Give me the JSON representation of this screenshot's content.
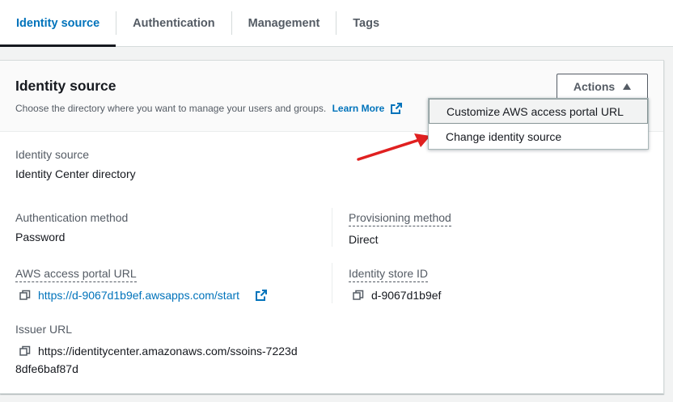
{
  "tabs": [
    {
      "label": "Identity source"
    },
    {
      "label": "Authentication"
    },
    {
      "label": "Management"
    },
    {
      "label": "Tags"
    }
  ],
  "panel": {
    "title": "Identity source",
    "description": "Choose the directory where you want to manage your users and groups.",
    "learn_more": "Learn More",
    "actions_label": "Actions"
  },
  "menu": {
    "items": [
      {
        "label": "Customize AWS access portal URL"
      },
      {
        "label": "Change identity source"
      }
    ]
  },
  "fields": {
    "identity_source": {
      "label": "Identity source",
      "value": "Identity Center directory"
    },
    "auth_method": {
      "label": "Authentication method",
      "value": "Password"
    },
    "provisioning": {
      "label": "Provisioning method",
      "value": "Direct"
    },
    "portal_url": {
      "label": "AWS access portal URL",
      "value": "https://d-9067d1b9ef.awsapps.com/start"
    },
    "identity_store": {
      "label": "Identity store ID",
      "value": "d-9067d1b9ef"
    },
    "issuer": {
      "label": "Issuer URL",
      "value_line1": "https://identitycenter.amazonaws.com/ssoins-7223d",
      "value_line2": "8dfe6baf87d"
    }
  },
  "colors": {
    "accent": "#0073bb",
    "annotation_arrow": "#e02020"
  },
  "icons": [
    "external-link-icon",
    "copy-icon",
    "caret-up-icon",
    "red-annotation-arrow"
  ]
}
